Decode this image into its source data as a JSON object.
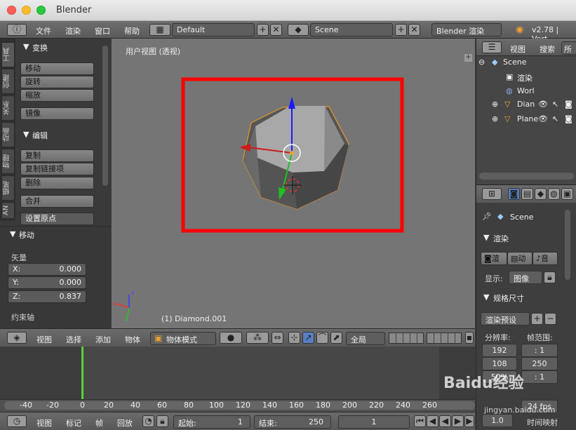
{
  "window": {
    "title": "Blender"
  },
  "infobar": {
    "menus": [
      "文件",
      "渲染",
      "窗口",
      "帮助"
    ],
    "screen_layout": "Default",
    "scene": "Scene",
    "engine": "Blender 渲染",
    "version": "v2.78 | Vert"
  },
  "toolshelf": {
    "tabs": [
      "工具",
      "创建",
      "关系",
      "动画",
      "物理",
      "蜡笔",
      "AN"
    ],
    "transform": {
      "title": "变换",
      "buttons": [
        "移动",
        "旋转",
        "缩放",
        "镜像"
      ]
    },
    "edit": {
      "title": "编辑",
      "buttons": [
        "复制",
        "复制链接项",
        "删除",
        "合并"
      ],
      "origin": "设置原点"
    }
  },
  "operator": {
    "title": "移动",
    "vector_label": "矢量",
    "x_label": "X:",
    "x_value": "0.000",
    "y_label": "Y:",
    "y_value": "0.000",
    "z_label": "Z:",
    "z_value": "0.837",
    "constraint_label": "约束轴"
  },
  "viewport": {
    "view_label": "用户视图 (透视)",
    "object_label": "(1) Diamond.001",
    "axis_x": "x",
    "axis_z": "z"
  },
  "v3dheader": {
    "menus": [
      "视图",
      "选择",
      "添加",
      "物体"
    ],
    "mode": "物体模式",
    "pivot": "全局"
  },
  "timeline": {
    "ticks": [
      "-40",
      "-20",
      "0",
      "20",
      "40",
      "60",
      "80",
      "100",
      "120",
      "140",
      "160",
      "180",
      "200",
      "220",
      "240",
      "260"
    ],
    "menus": [
      "视图",
      "标记",
      "帧",
      "回放"
    ],
    "start_label": "起始:",
    "start_value": "1",
    "end_label": "结束:",
    "end_value": "250",
    "current": "1"
  },
  "outliner": {
    "menus": [
      "视图",
      "搜索"
    ],
    "tab_label": "所",
    "items": [
      "Scene",
      "渲染",
      "Worl",
      "Dian",
      "Plane"
    ]
  },
  "properties": {
    "scene_label": "Scene",
    "render_panel": "渲染",
    "render_buttons": [
      "渲",
      "动",
      "音"
    ],
    "display_label": "显示:",
    "display_value": "图像",
    "dimensions_panel": "规格尺寸",
    "preset": "渲染预设",
    "resolution_label": "分辨率:",
    "res_x": "192",
    "res_y": "108",
    "res_pct": "50%",
    "frame_range_label": "帧范围:",
    "frame_start": ": 1",
    "frame_end": "250",
    "frame_step": ": 1",
    "fps": "24 fps",
    "time_remap_label": "时间映射",
    "aspect_val": "1.0"
  },
  "watermark": {
    "text": "Baidu经验",
    "sub": "jingyan.baidu.com"
  }
}
